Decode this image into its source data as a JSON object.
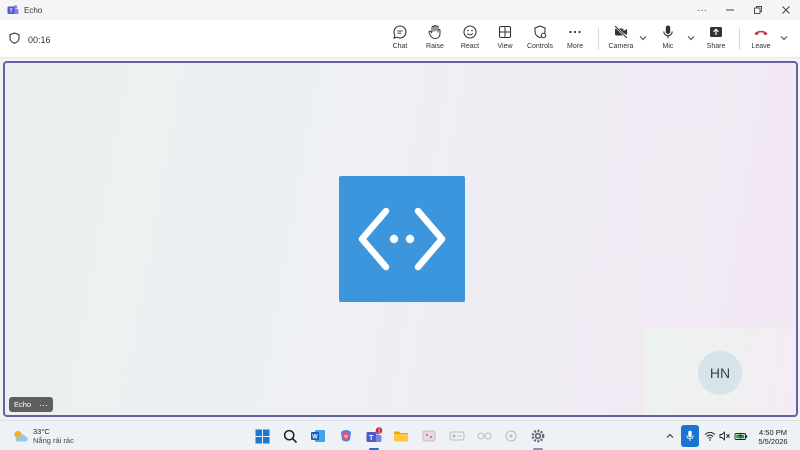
{
  "window": {
    "title": "Echo"
  },
  "toolbar": {
    "timer": "00:16",
    "chat": "Chat",
    "raise": "Raise",
    "react": "React",
    "view": "View",
    "controls": "Controls",
    "more": "More",
    "camera": "Camera",
    "mic": "Mic",
    "share": "Share",
    "leave": "Leave"
  },
  "stage": {
    "participant_name": "Echo",
    "self_initials": "HN"
  },
  "taskbar": {
    "weather_temp": "33°C",
    "weather_desc": "Nắng rải rác",
    "teams_badge": "1",
    "time": "4:50 PM",
    "date": "5/5/2026"
  },
  "colors": {
    "accent": "#6264a7",
    "echo_tile": "#3b96dd",
    "leave": "#c4314b",
    "taskbar_active": "#1b74d1"
  }
}
